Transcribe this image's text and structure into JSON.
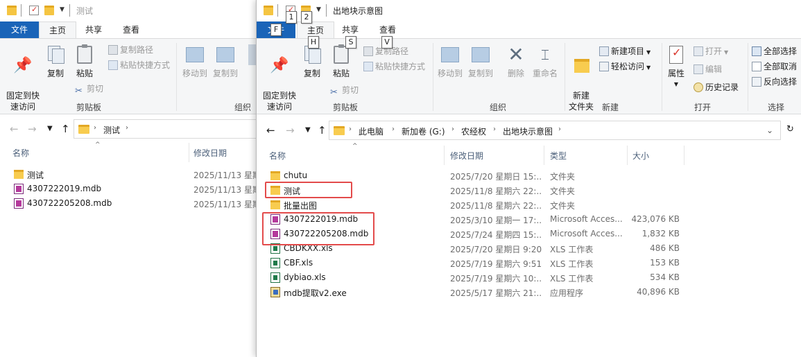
{
  "colors": {
    "file_tab": "#1a64b8",
    "highlight": "#e34b4b",
    "folder": "#f8cc4f"
  },
  "left": {
    "title": "测试",
    "tabs": {
      "file": "文件",
      "home": "主页",
      "share": "共享",
      "view": "查看"
    },
    "ribbon": {
      "pin": "固定到快\n速访问",
      "copy": "复制",
      "paste": "粘贴",
      "copy_path": "复制路径",
      "paste_shortcut": "粘贴快捷方式",
      "cut": "剪切",
      "clipboard_group": "剪贴板",
      "move_to": "移动到",
      "copy_to": "复制到",
      "organize_group": "组织"
    },
    "address": {
      "crumb": "测试"
    },
    "columns": {
      "name": "名称",
      "date": "修改日期"
    },
    "files": [
      {
        "name": "测试",
        "type": "folder",
        "date": "2025/11/13 星期"
      },
      {
        "name": "4307222019.mdb",
        "type": "mdb",
        "date": "2025/11/13 星期"
      },
      {
        "name": "430722205208.mdb",
        "type": "mdb",
        "date": "2025/11/13 星期"
      }
    ]
  },
  "right": {
    "title": "出地块示意图",
    "keytips": {
      "q1": "1",
      "q2": "2",
      "file": "F",
      "home": "H",
      "share": "S",
      "view": "V"
    },
    "tabs": {
      "file": "文件",
      "home": "主页",
      "share": "共享",
      "view": "查看"
    },
    "ribbon": {
      "pin": "固定到快\n速访问",
      "copy": "复制",
      "paste": "粘贴",
      "copy_path": "复制路径",
      "paste_shortcut": "粘贴快捷方式",
      "cut": "剪切",
      "clipboard_group": "剪贴板",
      "move_to": "移动到",
      "copy_to": "复制到",
      "delete": "删除",
      "rename": "重命名",
      "organize_group": "组织",
      "new_folder": "新建\n文件夹",
      "new_item": "新建项目",
      "easy_access": "轻松访问",
      "new_group": "新建",
      "properties": "属性",
      "open": "打开",
      "edit": "编辑",
      "history": "历史记录",
      "open_group": "打开",
      "select_all": "全部选择",
      "select_none": "全部取消",
      "invert_selection": "反向选择",
      "select_group": "选择"
    },
    "address": {
      "crumbs": [
        "此电脑",
        "新加卷 (G:)",
        "农经权",
        "出地块示意图"
      ]
    },
    "columns": {
      "name": "名称",
      "date": "修改日期",
      "type": "类型",
      "size": "大小"
    },
    "files": [
      {
        "name": "chutu",
        "icon": "folder",
        "date": "2025/7/20 星期日 15:...",
        "type": "文件夹",
        "size": ""
      },
      {
        "name": "测试",
        "icon": "folder",
        "date": "2025/11/8 星期六 22:...",
        "type": "文件夹",
        "size": ""
      },
      {
        "name": "批量出图",
        "icon": "folder",
        "date": "2025/11/8 星期六 22:...",
        "type": "文件夹",
        "size": ""
      },
      {
        "name": "4307222019.mdb",
        "icon": "mdb",
        "date": "2025/3/10 星期一 17:...",
        "type": "Microsoft Acces...",
        "size": "423,076 KB"
      },
      {
        "name": "430722205208.mdb",
        "icon": "mdb",
        "date": "2025/7/24 星期四 15:...",
        "type": "Microsoft Acces...",
        "size": "1,832 KB"
      },
      {
        "name": "CBDKXX.xls",
        "icon": "xls",
        "date": "2025/7/20 星期日 9:20",
        "type": "XLS 工作表",
        "size": "486 KB"
      },
      {
        "name": "CBF.xls",
        "icon": "xls",
        "date": "2025/7/19 星期六 9:51",
        "type": "XLS 工作表",
        "size": "153 KB"
      },
      {
        "name": "dybiao.xls",
        "icon": "xls",
        "date": "2025/7/19 星期六 10:...",
        "type": "XLS 工作表",
        "size": "534 KB"
      },
      {
        "name": "mdb提取v2.exe",
        "icon": "exe",
        "date": "2025/5/17 星期六 21:...",
        "type": "应用程序",
        "size": "40,896 KB"
      }
    ]
  }
}
